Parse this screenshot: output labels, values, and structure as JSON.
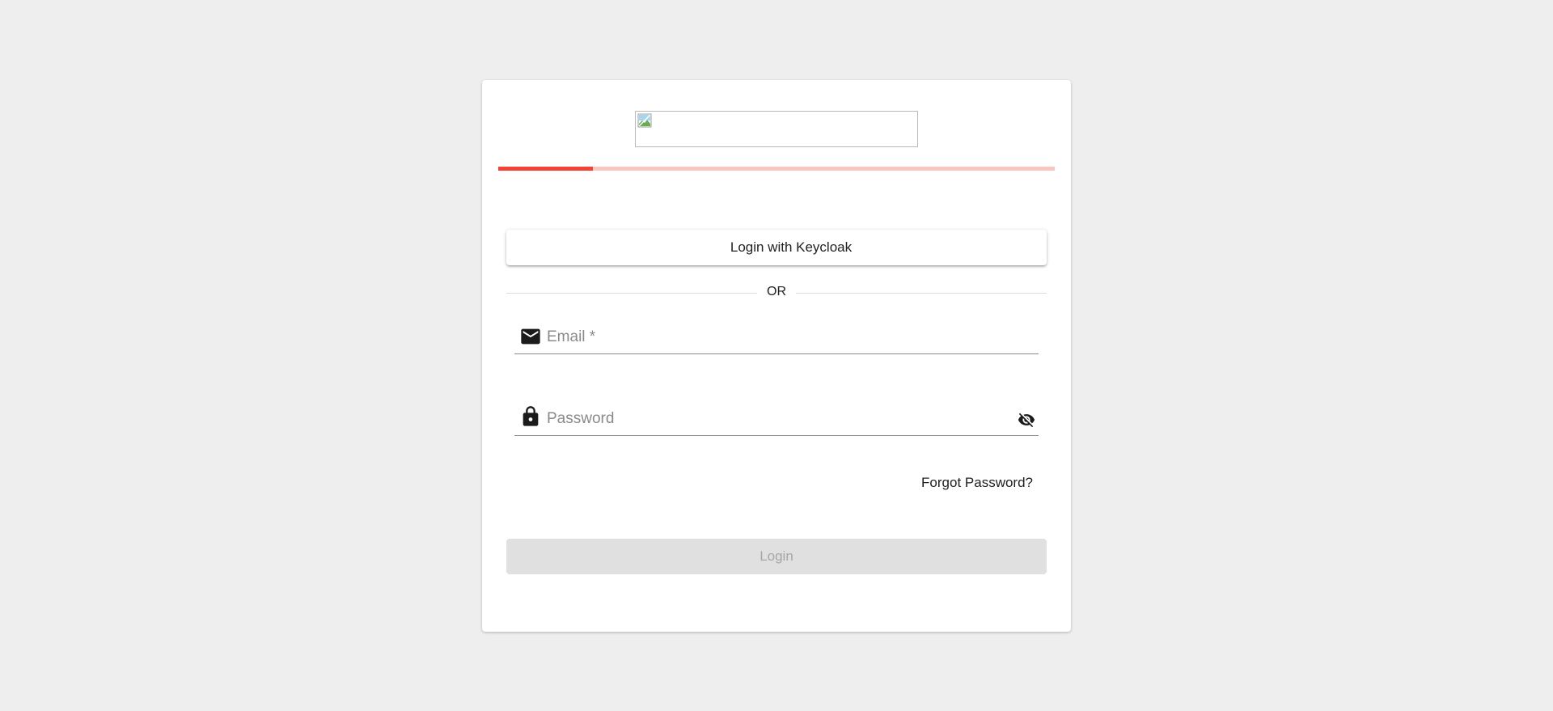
{
  "theme": {
    "background": "#eeeeee",
    "card": "#ffffff",
    "accent": "#f44336",
    "accent_light": "#f9c5c1",
    "disabled_bg": "#e0e0e0",
    "disabled_text": "#a6a6a6"
  },
  "logo": {
    "alt": "",
    "icon": "broken-image-icon"
  },
  "progress": {
    "value": 0.17
  },
  "sso": {
    "label": "Login with Keycloak"
  },
  "divider": {
    "label": "OR"
  },
  "email": {
    "icon": "mail-icon",
    "placeholder": "Email *",
    "value": ""
  },
  "password": {
    "icon": "lock-icon",
    "toggle_icon": "eye-off-icon",
    "placeholder": "Password",
    "value": ""
  },
  "forgot": {
    "label": "Forgot Password?"
  },
  "login": {
    "label": "Login",
    "disabled": true
  }
}
